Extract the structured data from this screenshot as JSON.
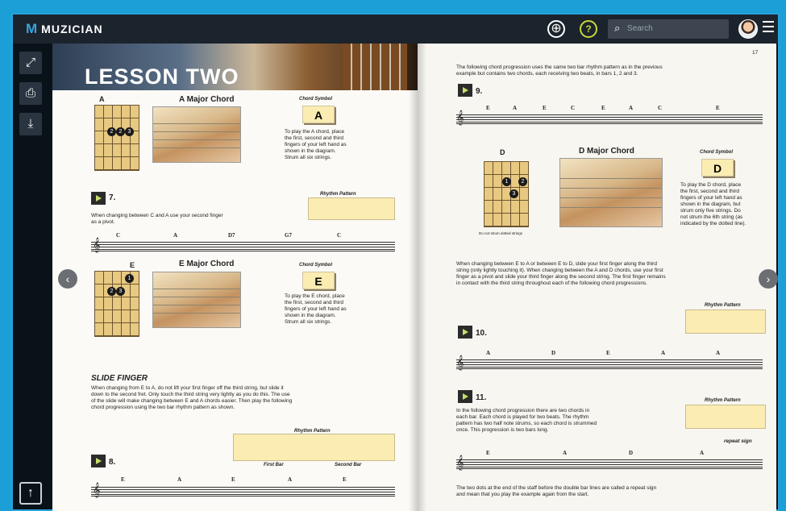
{
  "app": {
    "logo_mark": "M",
    "logo_text": "MUZICIAN"
  },
  "topbar": {
    "add_icon": "⊕",
    "help_icon": "?",
    "search_placeholder": "Search",
    "search_icon": "🔍"
  },
  "sidebar": {
    "fullscreen_icon": "⤢",
    "print_icon": "⎙",
    "download_icon": "⤓",
    "up_icon": "↑"
  },
  "nav": {
    "prev": "‹",
    "next": "›"
  },
  "left_page": {
    "lesson_title": "LESSON TWO",
    "a_chord": {
      "diagram_label": "A",
      "title": "A Major Chord",
      "symbol_label": "Chord Symbol",
      "symbol": "A",
      "desc": [
        "To play the A chord, place",
        "the first, second and third",
        "fingers of your left hand as",
        "shown in the diagram.",
        "Strum all six strings."
      ]
    },
    "ex7": {
      "number": "7.",
      "rhythm_label": "Rhythm Pattern",
      "text": [
        "When changing between C and A use your second finger",
        "as a pivot."
      ],
      "chords": [
        "C",
        "A",
        "D7",
        "G7",
        "C"
      ]
    },
    "e_chord": {
      "diagram_label": "E",
      "title": "E Major Chord",
      "symbol_label": "Chord Symbol",
      "symbol": "E",
      "desc": [
        "To play the E chord, place",
        "the first, second and third",
        "fingers of your left hand as",
        "shown in the diagram.",
        "Strum all six strings."
      ]
    },
    "slide": {
      "heading": "SLIDE FINGER",
      "text": [
        "When changing from E to A, do not lift your first finger off the third string, but slide it",
        "down to the second fret. Only touch the third string very lightly as you do this. The use",
        "of the slide will make changing between E and A chords easier. Then play the following",
        "chord progression using the two bar rhythm pattern as shown."
      ]
    },
    "ex8": {
      "number": "8.",
      "rhythm_label": "Rhythm Pattern",
      "first_bar": "First Bar",
      "second_bar": "Second Bar",
      "chords": [
        "E",
        "A",
        "E",
        "A",
        "E"
      ]
    }
  },
  "right_page": {
    "page_number": "17",
    "intro": [
      "The following chord progression uses the same two bar rhythm pattern as in the previous",
      "example but contains two chords, each receiving two beats, in bars 1, 2 and 3."
    ],
    "ex9": {
      "number": "9.",
      "chords": [
        "E",
        "A",
        "E",
        "C",
        "E",
        "A",
        "C",
        "E"
      ]
    },
    "d_chord": {
      "diagram_label": "D",
      "title": "D Major Chord",
      "symbol_label": "Chord Symbol",
      "symbol": "D",
      "caption": "Do not strum dotted strings",
      "desc": [
        "To play the D chord, place",
        "the first, second and third",
        "fingers of your left hand as",
        "shown in the diagram, but",
        "strum only five strings. Do",
        "not strum the 6th string (as",
        "indicated by the dotted line)."
      ]
    },
    "change_text": [
      "When changing between E to A or between E to D, slide your first finger along the third",
      "string (only lightly touching it). When changing between the A and D chords, use your first",
      "finger as a pivot and slide your third finger along the second string. The first finger remains",
      "in contact with the third string throughout each of the following chord progressions."
    ],
    "ex10": {
      "number": "10.",
      "rhythm_label": "Rhythm Pattern",
      "chords": [
        "A",
        "D",
        "E",
        "A",
        "A"
      ]
    },
    "ex11": {
      "number": "11.",
      "rhythm_label": "Rhythm Pattern",
      "text": [
        "In the following chord progression there are two chords in",
        "each bar. Each chord is played for two beats. The rhythm",
        "pattern has two half note strums, so each chord is strummed",
        "once. This progression is two bars long."
      ],
      "repeat_label": "repeat sign",
      "chords": [
        "E",
        "A",
        "D",
        "A"
      ]
    },
    "footer": [
      "The two dots at the end of the staff before the double bar lines are called a repeat sign",
      "and mean that you play the example again from the start."
    ]
  },
  "colors": {
    "accent": "#1b9fd6",
    "topbar": "#1b232c",
    "chord_box": "#fbecb2"
  }
}
